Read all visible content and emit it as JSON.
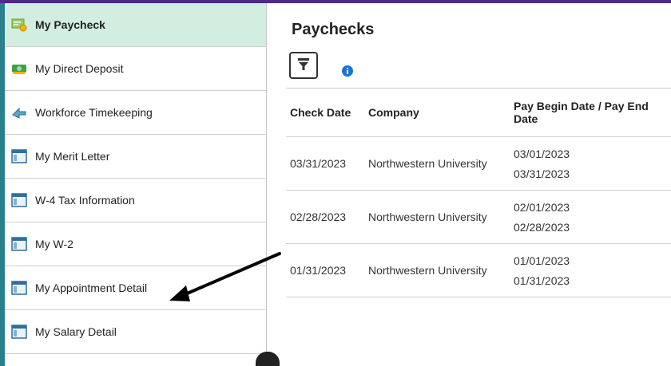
{
  "sidebar": {
    "items": [
      {
        "label": "My Paycheck",
        "icon": "paycheck-icon",
        "active": true
      },
      {
        "label": "My Direct Deposit",
        "icon": "money-icon",
        "active": false
      },
      {
        "label": "Workforce Timekeeping",
        "icon": "arrow-icon",
        "active": false
      },
      {
        "label": "My Merit Letter",
        "icon": "window-icon",
        "active": false
      },
      {
        "label": "W-4 Tax Information",
        "icon": "window-icon",
        "active": false
      },
      {
        "label": "My W-2",
        "icon": "window-icon",
        "active": false
      },
      {
        "label": "My Appointment Detail",
        "icon": "window-icon",
        "active": false
      },
      {
        "label": "My Salary Detail",
        "icon": "window-icon",
        "active": false
      }
    ]
  },
  "main": {
    "title": "Paychecks",
    "table": {
      "headers": [
        "Check Date",
        "Company",
        "Pay Begin Date / Pay End Date"
      ],
      "rows": [
        {
          "check_date": "03/31/2023",
          "company": "Northwestern University",
          "pay_begin": "03/01/2023",
          "pay_end": "03/31/2023"
        },
        {
          "check_date": "02/28/2023",
          "company": "Northwestern University",
          "pay_begin": "02/01/2023",
          "pay_end": "02/28/2023"
        },
        {
          "check_date": "01/31/2023",
          "company": "Northwestern University",
          "pay_begin": "01/01/2023",
          "pay_end": "01/31/2023"
        }
      ]
    }
  },
  "colors": {
    "brand_purple": "#4e2a84",
    "sidebar_accent": "#2a7f8c",
    "active_bg": "#d2eee0",
    "info_blue": "#1a73d9"
  }
}
